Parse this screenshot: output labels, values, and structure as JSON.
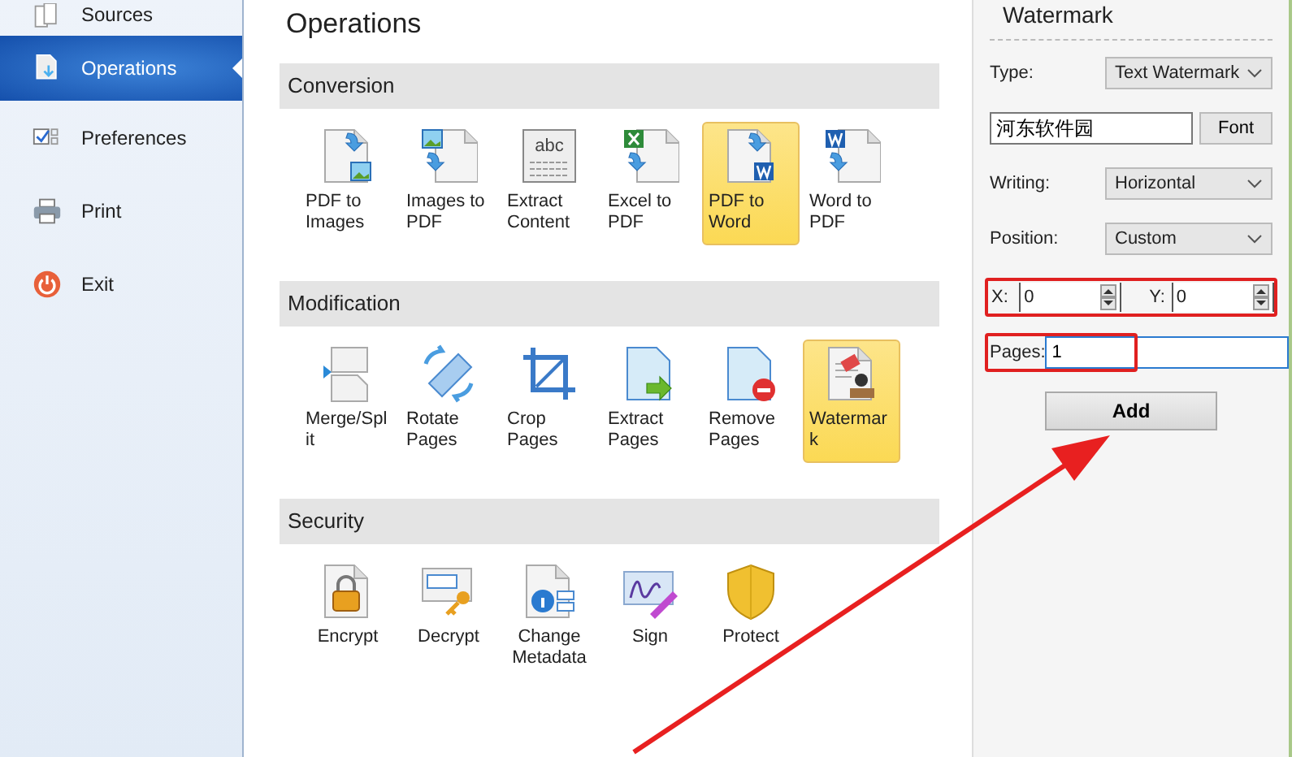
{
  "sidebar": {
    "items": [
      {
        "label": "Sources",
        "kind": "pages",
        "selected": false
      },
      {
        "label": "Operations",
        "kind": "document",
        "selected": true
      },
      {
        "label": "Preferences",
        "kind": "checklist",
        "selected": false
      },
      {
        "label": "Print",
        "kind": "printer",
        "selected": false
      },
      {
        "label": "Exit",
        "kind": "power",
        "selected": false
      }
    ]
  },
  "main": {
    "title": "Operations",
    "sections": [
      {
        "title": "Conversion",
        "tools": [
          {
            "label": "PDF to Images",
            "kind": "pdf-to-images",
            "selected": false
          },
          {
            "label": "Images to PDF",
            "kind": "images-to-pdf",
            "selected": false
          },
          {
            "label": "Extract Content",
            "kind": "extract-content",
            "icon_text": "abc",
            "selected": false
          },
          {
            "label": "Excel to PDF",
            "kind": "excel-to-pdf",
            "selected": false
          },
          {
            "label": "PDF to Word",
            "kind": "pdf-to-word",
            "selected": true
          },
          {
            "label": "Word to PDF",
            "kind": "word-to-pdf",
            "selected": false
          }
        ]
      },
      {
        "title": "Modification",
        "tools": [
          {
            "label": "Merge/Split",
            "kind": "merge-split",
            "selected": false
          },
          {
            "label": "Rotate Pages",
            "kind": "rotate",
            "selected": false
          },
          {
            "label": "Crop Pages",
            "kind": "crop",
            "selected": false
          },
          {
            "label": "Extract Pages",
            "kind": "extract-pages",
            "selected": false
          },
          {
            "label": "Remove Pages",
            "kind": "remove-pages",
            "selected": false
          },
          {
            "label": "Watermark",
            "kind": "watermark",
            "selected": true
          }
        ]
      },
      {
        "title": "Security",
        "tools": [
          {
            "label": "Encrypt",
            "kind": "encrypt",
            "selected": false
          },
          {
            "label": "Decrypt",
            "kind": "decrypt",
            "selected": false
          },
          {
            "label": "Change Metadata",
            "kind": "metadata",
            "selected": false
          },
          {
            "label": "Sign",
            "kind": "sign",
            "selected": false
          },
          {
            "label": "Protect",
            "kind": "protect",
            "selected": false
          }
        ]
      }
    ]
  },
  "watermark_panel": {
    "title": "Watermark",
    "type": {
      "label": "Type:",
      "value": "Text Watermark"
    },
    "text": {
      "value": "河东软件园",
      "button": "Font"
    },
    "writing": {
      "label": "Writing:",
      "value": "Horizontal"
    },
    "position": {
      "label": "Position:",
      "value": "Custom"
    },
    "x": {
      "label": "X:",
      "value": "0"
    },
    "y": {
      "label": "Y:",
      "value": "0"
    },
    "pages": {
      "label": "Pages:",
      "value": "1"
    },
    "add_button": "Add"
  }
}
